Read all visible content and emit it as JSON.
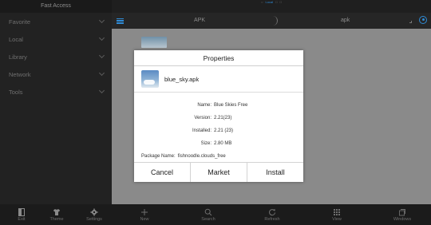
{
  "sidebar": {
    "header": "Fast Access",
    "items": [
      {
        "label": "Favorite"
      },
      {
        "label": "Local"
      },
      {
        "label": "Library"
      },
      {
        "label": "Network"
      },
      {
        "label": "Tools"
      }
    ]
  },
  "status": {
    "active": "Local"
  },
  "tabs": {
    "left": "APK",
    "right": "apk"
  },
  "dialog": {
    "title": "Properties",
    "file_name": "blue_sky.apk",
    "properties": [
      {
        "label": "Name:",
        "value": "Blue Skies Free"
      },
      {
        "label": "Version:",
        "value": "2.21(23)"
      },
      {
        "label": "Installed:",
        "value": "2.21 (23)"
      },
      {
        "label": "Size:",
        "value": "2.80 MB"
      }
    ],
    "package": {
      "label": "Package Name:",
      "value": "fishnoodle.clouds_free"
    },
    "buttons": {
      "cancel": "Cancel",
      "market": "Market",
      "install": "Install"
    }
  },
  "bottombar": {
    "left": [
      {
        "label": "Exit",
        "icon": "exit-icon"
      },
      {
        "label": "Theme",
        "icon": "shirt-icon"
      },
      {
        "label": "Settings",
        "icon": "gear-icon"
      }
    ],
    "right": [
      {
        "label": "New",
        "icon": "plus-icon"
      },
      {
        "label": "Search",
        "icon": "search-icon"
      },
      {
        "label": "Refresh",
        "icon": "refresh-icon"
      },
      {
        "label": "View",
        "icon": "grid-icon"
      },
      {
        "label": "Windows",
        "icon": "windows-icon"
      }
    ]
  },
  "colors": {
    "accent": "#2f8bd6",
    "sidebar_bg": "#222222",
    "overlay_bg": "#8a8a8a"
  }
}
